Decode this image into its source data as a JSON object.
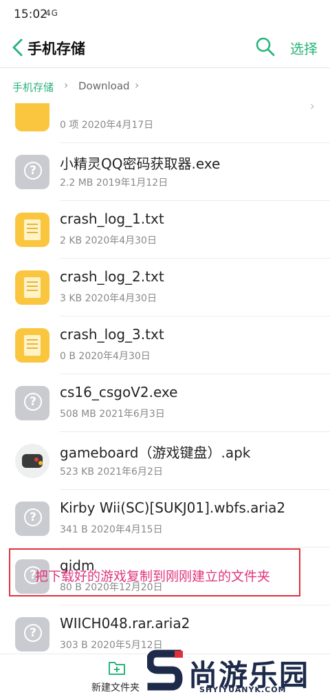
{
  "status": {
    "time": "15:02",
    "signal": "4G"
  },
  "header": {
    "title": "手机存储",
    "select_label": "选择"
  },
  "breadcrumb": {
    "root": "手机存储",
    "current": "Download"
  },
  "files": [
    {
      "name": "",
      "meta": "0 项  2020年4月17日",
      "type": "folder"
    },
    {
      "name": "小精灵QQ密码获取器.exe",
      "meta": "2.2 MB  2019年1月12日",
      "type": "unknown"
    },
    {
      "name": "crash_log_1.txt",
      "meta": "2 KB  2020年4月30日",
      "type": "text"
    },
    {
      "name": "crash_log_2.txt",
      "meta": "3 KB  2020年4月30日",
      "type": "text"
    },
    {
      "name": "crash_log_3.txt",
      "meta": "0 B  2020年4月30日",
      "type": "text"
    },
    {
      "name": "cs16_csgoV2.exe",
      "meta": "508 MB  2021年6月3日",
      "type": "unknown"
    },
    {
      "name": "gameboard（游戏键盘）.apk",
      "meta": "523 KB  2021年6月2日",
      "type": "app"
    },
    {
      "name": "Kirby Wii(SC)[SUKJ01].wbfs.aria2",
      "meta": "341 B  2020年4月15日",
      "type": "unknown"
    },
    {
      "name": "gidm",
      "meta": "80 B  2020年12月20日",
      "type": "unknown"
    },
    {
      "name": "WIICH048.rar.aria2",
      "meta": "303 B  2020年5月12日",
      "type": "unknown"
    }
  ],
  "annotation": {
    "text": "把下载好的游戏复制到刚刚建立的文件夹"
  },
  "bottom_bar": {
    "new_folder_label": "新建文件夹"
  },
  "watermark": {
    "brand": "尚游乐园",
    "url": "SHYIYUANYK.COM"
  },
  "colors": {
    "accent": "#2ab37d",
    "annotation_border": "#e12f3a",
    "annotation_text": "#e0357e"
  }
}
